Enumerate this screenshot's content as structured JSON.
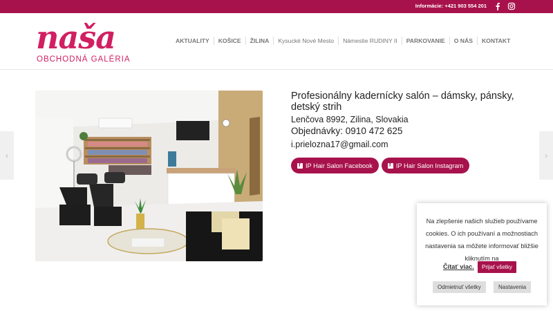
{
  "topbar": {
    "info": "Informácie: +421 903 554 201",
    "facebook_icon": "facebook-icon",
    "instagram_icon": "instagram-icon"
  },
  "logo": {
    "word": "naša",
    "sub": "OBCHODNÁ GALÉRIA"
  },
  "nav": [
    {
      "label": "AKTUALITY"
    },
    {
      "label": "KOŠICE"
    },
    {
      "label": "ŽILINA"
    },
    {
      "label": "Kysucké Nové Mesto"
    },
    {
      "label": "Námestie RUDINY II"
    },
    {
      "label": "PARKOVANIE"
    },
    {
      "label": "O NÁS"
    },
    {
      "label": "KONTAKT"
    }
  ],
  "store": {
    "title": "Profesionálny kadernícky salón – dámsky, pánsky, detský strih",
    "address": "Lenčova 8992, Zilina, Slovakia",
    "phone": "Objednávky: 0910 472 625",
    "email": "i.prielozna17@gmail.com",
    "buttons": [
      {
        "label": "IP Hair Salon Facebook"
      },
      {
        "label": "IP Hair Salon Instagram"
      }
    ]
  },
  "cookie": {
    "text": "Na zlepšenie našich služieb používame cookies. O ich používaní a možnostiach nastavenia sa môžete informovať bližšie kliknutím na",
    "read_more": "Čítať viac.",
    "accept": "Prijať všetky",
    "reject": "Odmietnuť všetky",
    "settings": "Nastavenia"
  },
  "colors": {
    "brand": "#a8124c",
    "logo": "#d11f61"
  }
}
